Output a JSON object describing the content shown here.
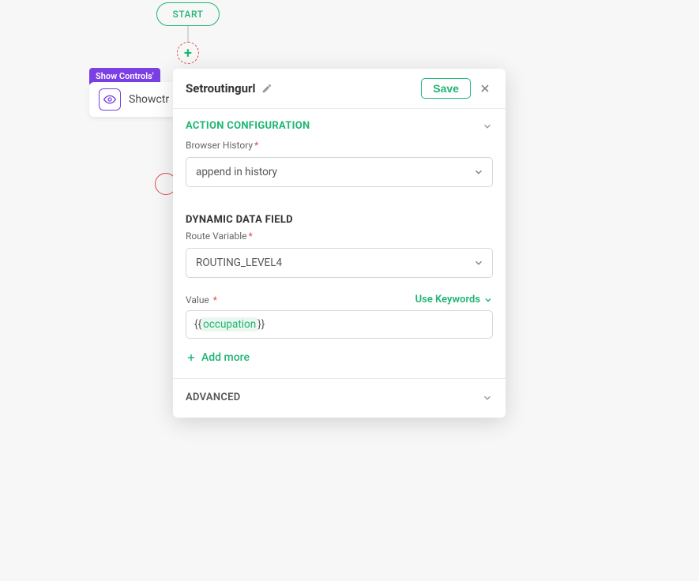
{
  "canvas": {
    "start_label": "START",
    "badge_label": "Show Controls'",
    "card_label": "Showctr",
    "add_symbol": "+"
  },
  "panel": {
    "title": "Setroutingurl",
    "save_label": "Save",
    "sections": {
      "action_config_title": "ACTION CONFIGURATION",
      "dynamic_title": "DYNAMIC DATA FIELD",
      "advanced_title": "ADVANCED"
    },
    "browser_history": {
      "label": "Browser History",
      "value": "append in history"
    },
    "route_variable": {
      "label": "Route Variable",
      "value": "ROUTING_LEVEL4"
    },
    "value_field": {
      "label": "Value",
      "use_keywords_label": "Use Keywords",
      "brace_open": "{{",
      "keyword": "occupation",
      "brace_close": "}}"
    },
    "add_more_label": "Add more"
  }
}
